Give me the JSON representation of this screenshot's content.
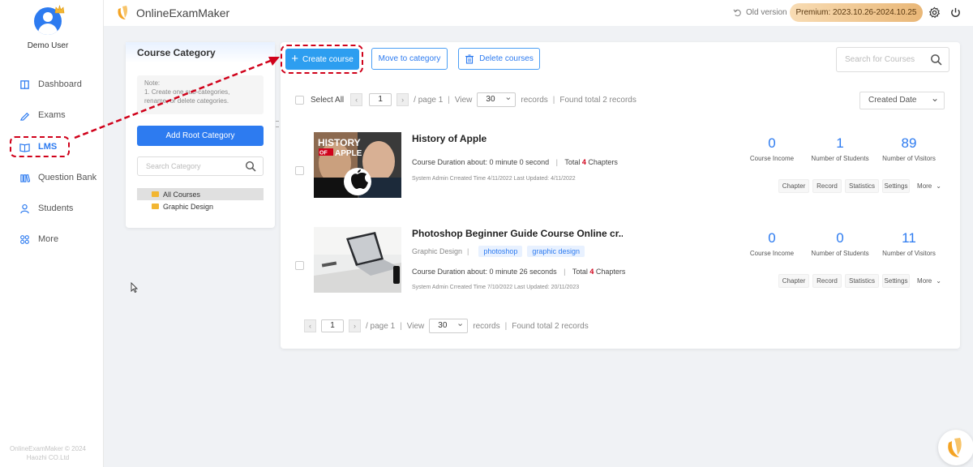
{
  "app": {
    "name": "OnlineExamMaker",
    "old_version": "Old version",
    "premium": "Premium:  2023.10.26-2024.10.25"
  },
  "user": {
    "name": "Demo User"
  },
  "sidebar": {
    "items": [
      {
        "label": "Dashboard",
        "icon": "dashboard-icon"
      },
      {
        "label": "Exams",
        "icon": "exams-icon"
      },
      {
        "label": "LMS",
        "icon": "book-icon",
        "active": true
      },
      {
        "label": "Question Bank",
        "icon": "question-bank-icon"
      },
      {
        "label": "Students",
        "icon": "students-icon"
      },
      {
        "label": "More",
        "icon": "more-icon"
      }
    ],
    "copyright_line1": "OnlineExamMaker © 2024",
    "copyright_line2": "Haozhi CO.Ltd"
  },
  "category_panel": {
    "title": "Course Category",
    "note_title": "Note:",
    "note_line1": "1. Create one sub-categories,",
    "note_line2": "rename, or delete categories.",
    "add_root_label": "Add Root Category",
    "search_placeholder": "Search Category",
    "tree": [
      {
        "label": "All Courses",
        "selected": true
      },
      {
        "label": "Graphic Design",
        "selected": false
      }
    ]
  },
  "toolbar": {
    "create_label": "Create course",
    "move_label": "Move to category",
    "delete_label": "Delete courses",
    "search_placeholder": "Search for Courses"
  },
  "pager_top": {
    "select_all": "Select All",
    "page": "1",
    "page_suffix": "/ page 1",
    "view": "View",
    "records_per_page": "30",
    "records": "records",
    "found": "Found total 2 records"
  },
  "sort": {
    "selected": "Created Date"
  },
  "courses": [
    {
      "title": "History of Apple",
      "duration": "Course Duration about: 0 minute 0 second",
      "total_label": "Total",
      "chapters_count": "4",
      "chapters_label": "Chapters",
      "sub": "System Admin Crreated Time 4/11/2022 Last Updated: 4/11/2022",
      "thumb_text1": "HISTORY",
      "thumb_text2": "OF APPLE",
      "income": "0",
      "students": "1",
      "visitors": "89"
    },
    {
      "title": "Photoshop Beginner Guide Course Online cr...",
      "category": "Graphic Design",
      "tags": [
        "photoshop",
        "graphic design"
      ],
      "duration": "Course Duration about: 0 minute 26 seconds",
      "total_label": "Total",
      "chapters_count": "4",
      "chapters_label": "Chapters",
      "sub": "System Admin Crreated Time 7/10/2022 Last Updated: 20/11/2023",
      "income": "0",
      "students": "0",
      "visitors": "11"
    }
  ],
  "stat_labels": {
    "income": "Course Income",
    "students": "Number of Students",
    "visitors": "Number of Visitors"
  },
  "actions": {
    "chapter": "Chapter",
    "record": "Record",
    "statistics": "Statistics",
    "settings": "Settings",
    "more": "More"
  },
  "pager_bottom": {
    "page": "1",
    "page_suffix": "/ page 1",
    "view": "View",
    "records_per_page": "30",
    "records": "records",
    "found": "Found total 2 records"
  },
  "colors": {
    "accent": "#2d7bf0",
    "highlight": "#d0021b",
    "premium": "#e9b777"
  }
}
